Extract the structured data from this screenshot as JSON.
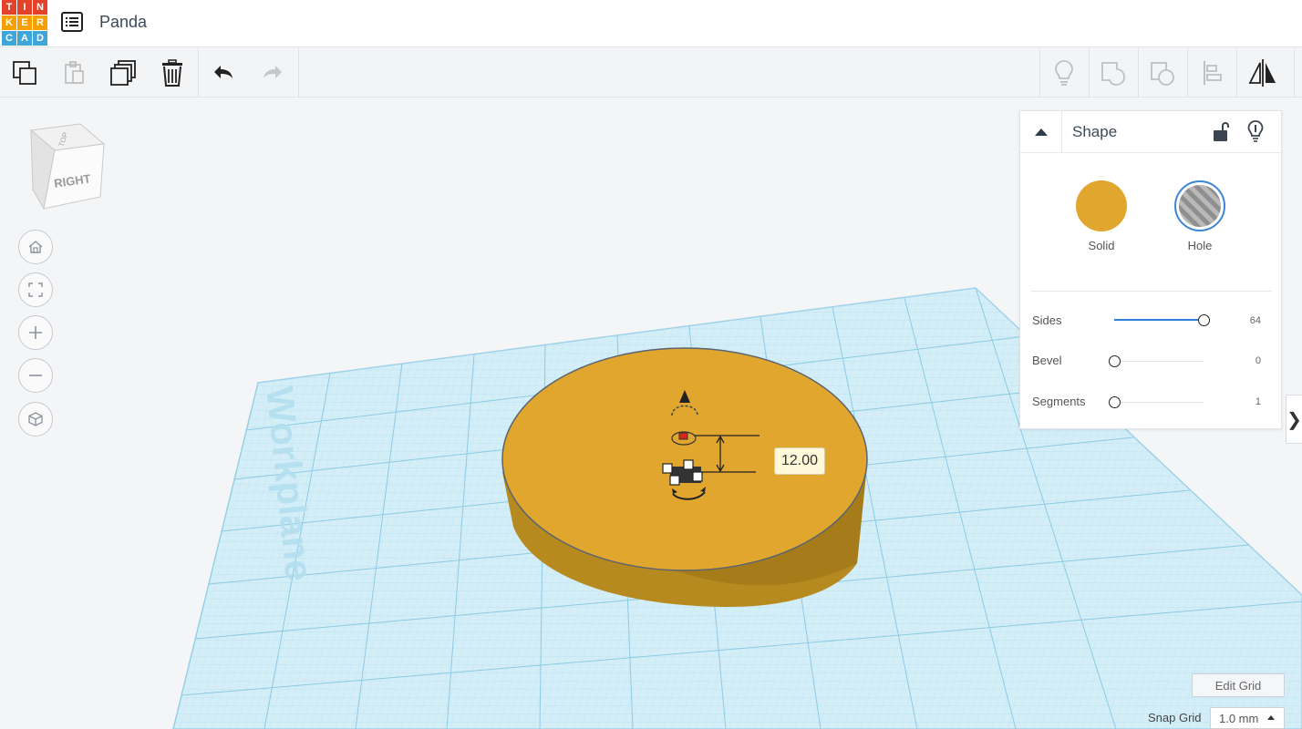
{
  "app": {
    "logo_letters": [
      "T",
      "I",
      "N",
      "K",
      "E",
      "R",
      "C",
      "A",
      "D"
    ],
    "logo_colors": [
      "#e2412a",
      "#e2412a",
      "#e2412a",
      "#f5a000",
      "#f5a000",
      "#f5a000",
      "#3ea6d8",
      "#3ea6d8",
      "#3ea6d8"
    ],
    "document_title": "Panda"
  },
  "toolbar": {
    "left_icons": [
      "copy-icon",
      "paste-icon",
      "duplicate-icon",
      "delete-icon",
      "undo-icon",
      "redo-icon"
    ],
    "right_icons": [
      "note-bulb-icon",
      "group-icon",
      "ungroup-icon",
      "align-icon",
      "mirror-icon"
    ]
  },
  "view_cube": {
    "face_front": "RIGHT",
    "face_top": "TOP"
  },
  "nav_controls": [
    "home-view-icon",
    "fit-view-icon",
    "zoom-in-icon",
    "zoom-out-icon",
    "perspective-icon"
  ],
  "workplane": {
    "label": "Workplane",
    "grid_color": "#a9d8ec",
    "background": "#d4eef8"
  },
  "selected_shape": {
    "color": "#e0a62e",
    "dimension_value": "12.00"
  },
  "inspector": {
    "title": "Shape",
    "solid_label": "Solid",
    "hole_label": "Hole",
    "solid_color": "#e0a62e",
    "properties": [
      {
        "label": "Sides",
        "value": "64",
        "fraction": 1.0
      },
      {
        "label": "Bevel",
        "value": "0",
        "fraction": 0.0
      },
      {
        "label": "Segments",
        "value": "1",
        "fraction": 0.0
      }
    ]
  },
  "footer": {
    "edit_grid_label": "Edit Grid",
    "snap_grid_label": "Snap Grid",
    "snap_grid_value": "1.0 mm"
  }
}
